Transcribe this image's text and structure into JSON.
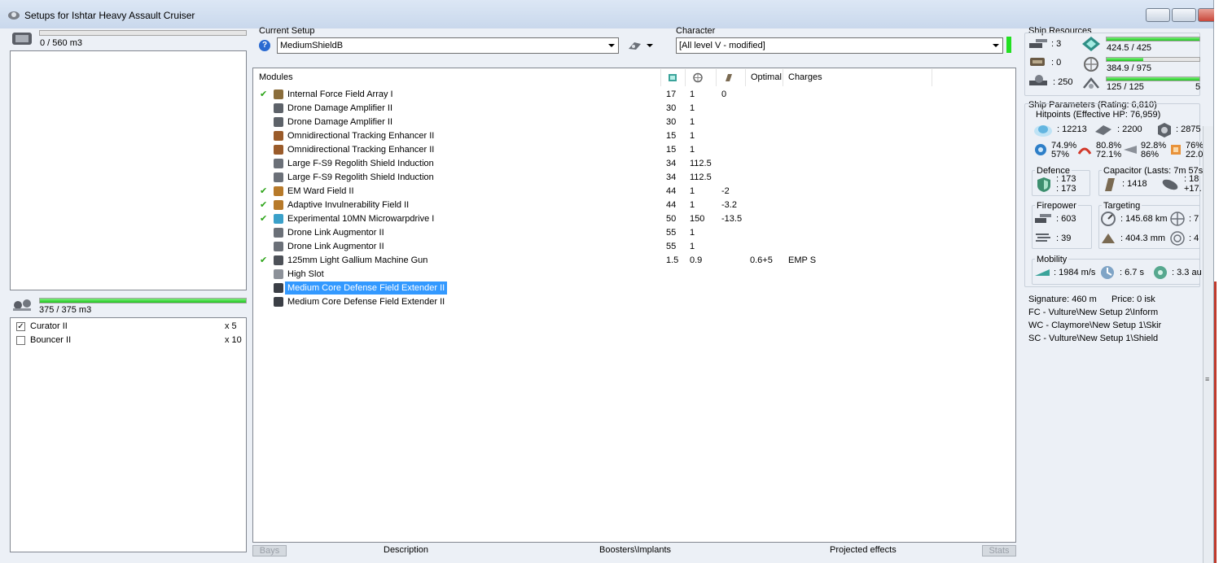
{
  "window": {
    "title": "Setups for Ishtar Heavy Assault Cruiser"
  },
  "cargo": {
    "label": "0 / 560 m3",
    "fill": 0
  },
  "drone_bay": {
    "label": "375 / 375 m3",
    "fill": 1.0,
    "items": [
      {
        "name": "Curator II",
        "qty": "x 5",
        "checked": true
      },
      {
        "name": "Bouncer II",
        "qty": "x 10",
        "checked": false
      }
    ]
  },
  "setup": {
    "heading": "Current Setup",
    "value": "MediumShieldB",
    "help_icon": "?"
  },
  "character": {
    "heading": "Character",
    "value": "[All level V - modified]"
  },
  "modules": {
    "columns": [
      "Modules",
      "",
      "",
      "",
      "Optimal",
      "Charges"
    ],
    "rows": [
      {
        "check": "✔",
        "name": "Internal Force Field Array I",
        "c1": "17",
        "c2": "1",
        "c3": "0",
        "c4": "",
        "c5": "",
        "icon": "armor"
      },
      {
        "check": "",
        "name": "Drone Damage Amplifier II",
        "c1": "30",
        "c2": "1",
        "c3": "",
        "c4": "",
        "c5": "",
        "icon": "drone"
      },
      {
        "check": "",
        "name": "Drone Damage Amplifier II",
        "c1": "30",
        "c2": "1",
        "c3": "",
        "c4": "",
        "c5": "",
        "icon": "drone"
      },
      {
        "check": "",
        "name": "Omnidirectional Tracking Enhancer II",
        "c1": "15",
        "c2": "1",
        "c3": "",
        "c4": "",
        "c5": "",
        "icon": "track"
      },
      {
        "check": "",
        "name": "Omnidirectional Tracking Enhancer II",
        "c1": "15",
        "c2": "1",
        "c3": "",
        "c4": "",
        "c5": "",
        "icon": "track"
      },
      {
        "check": "",
        "name": "Large F-S9 Regolith Shield Induction",
        "c1": "34",
        "c2": "112.5",
        "c3": "",
        "c4": "",
        "c5": "",
        "icon": "shield"
      },
      {
        "check": "",
        "name": "Large F-S9 Regolith Shield Induction",
        "c1": "34",
        "c2": "112.5",
        "c3": "",
        "c4": "",
        "c5": "",
        "icon": "shield"
      },
      {
        "check": "✔",
        "name": "EM Ward Field II",
        "c1": "44",
        "c2": "1",
        "c3": "-2",
        "c4": "",
        "c5": "",
        "icon": "ward"
      },
      {
        "check": "✔",
        "name": "Adaptive Invulnerability Field II",
        "c1": "44",
        "c2": "1",
        "c3": "-3.2",
        "c4": "",
        "c5": "",
        "icon": "ward"
      },
      {
        "check": "✔",
        "name": "Experimental 10MN Microwarpdrive I",
        "c1": "50",
        "c2": "150",
        "c3": "-13.5",
        "c4": "",
        "c5": "",
        "icon": "mwd"
      },
      {
        "check": "",
        "name": "Drone Link Augmentor II",
        "c1": "55",
        "c2": "1",
        "c3": "",
        "c4": "",
        "c5": "",
        "icon": "link"
      },
      {
        "check": "",
        "name": "Drone Link Augmentor II",
        "c1": "55",
        "c2": "1",
        "c3": "",
        "c4": "",
        "c5": "",
        "icon": "link"
      },
      {
        "check": "✔",
        "name": "125mm Light Gallium Machine Gun",
        "c1": "1.5",
        "c2": "0.9",
        "c3": "",
        "c4": "0.6+5",
        "c5": "EMP S",
        "icon": "gun"
      },
      {
        "check": "",
        "name": "High Slot",
        "c1": "",
        "c2": "",
        "c3": "",
        "c4": "",
        "c5": "",
        "icon": "slot"
      },
      {
        "check": "",
        "name": "Medium Core Defense Field Extender II",
        "c1": "",
        "c2": "",
        "c3": "",
        "c4": "",
        "c5": "",
        "icon": "ext",
        "selected": true
      },
      {
        "check": "",
        "name": "Medium Core Defense Field Extender II",
        "c1": "",
        "c2": "",
        "c3": "",
        "c4": "",
        "c5": "",
        "icon": "ext"
      }
    ]
  },
  "tabs": [
    "Bays",
    "Description",
    "Boosters\\Implants",
    "Projected effects",
    "Stats"
  ],
  "resources": {
    "heading": "Ship Resources",
    "turrets": ": 3",
    "launchers": ": 0",
    "drone_bw": ": 250",
    "cpu": "424.5 / 425",
    "cpu_fill": 0.9988,
    "pg": "384.9 / 975",
    "pg_fill": 0.395,
    "bw": "125 / 125",
    "bw_fill": 1.0,
    "bw_extra": "5"
  },
  "params": {
    "heading": "Ship Parameters (Rating: 6,810)",
    "hitpoints": "Hitpoints (Effective HP: 76,959)",
    "shield_hp": ": 12213",
    "armor_hp": ": 2200",
    "hull_hp": ": 2875",
    "res": [
      "74.9%",
      "57%",
      "80.8%",
      "72.1%",
      "92.8%",
      "86%",
      "76%",
      "22.0"
    ],
    "defence": "Defence",
    "def1": ": 173",
    "def2": ": 173",
    "capacitor": "Capacitor (Lasts: 7m 57s)",
    "cap1": ": 1418",
    "cap2": ": 18",
    "cap3": "+17.",
    "firepower": "Firepower",
    "fp1": ": 603",
    "fp2": ": 39",
    "targeting": "Targeting",
    "tg1": ": 145.68 km",
    "tg2": ": 7",
    "tg3": ": 404.3 mm",
    "tg4": ": 4",
    "mobility": "Mobility",
    "mob1": ": 1984 m/s",
    "mob2": ": 6.7 s",
    "mob3": ": 3.3 au",
    "signature": "Signature: 460 m",
    "price": "Price: 0 isk",
    "fleet": [
      "FC - Vulture\\New Setup 2\\Inform",
      "WC - Claymore\\New Setup 1\\Skir",
      "SC - Vulture\\New Setup 1\\Shield"
    ]
  }
}
